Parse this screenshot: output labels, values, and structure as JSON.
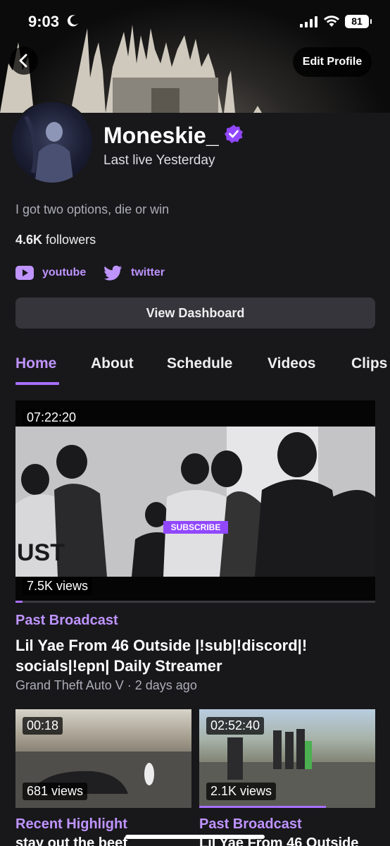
{
  "status_bar": {
    "time": "9:03",
    "battery": "81"
  },
  "header": {
    "edit_profile_label": "Edit Profile"
  },
  "profile": {
    "display_name": "Moneskie_",
    "last_live": "Last live Yesterday",
    "bio": "I got two options, die or win",
    "followers_count": "4.6K",
    "followers_label": "followers",
    "socials": [
      {
        "label": "youtube",
        "icon": "youtube-icon"
      },
      {
        "label": "twitter",
        "icon": "twitter-icon"
      }
    ],
    "view_dashboard_label": "View Dashboard"
  },
  "tabs": [
    {
      "label": "Home",
      "active": true
    },
    {
      "label": "About"
    },
    {
      "label": "Schedule"
    },
    {
      "label": "Videos"
    },
    {
      "label": "Clips"
    }
  ],
  "featured": {
    "duration": "07:22:20",
    "views": "7.5K views",
    "overlay_text": "SUBSCRIBE",
    "category": "Past Broadcast",
    "title": "Lil Yae From 46 Outside |!sub|!discord|! socials|!epn| Daily Streamer",
    "meta": "Grand Theft Auto V · 2 days ago",
    "progress": 0.02
  },
  "videos": [
    {
      "duration": "00:18",
      "views": "681 views",
      "category": "Recent Highlight",
      "title": "stay out the beef",
      "progress": 0.0
    },
    {
      "duration": "02:52:40",
      "views": "2.1K views",
      "category": "Past Broadcast",
      "title": "Lil Yae From 46 Outside",
      "progress": 0.72
    }
  ],
  "colors": {
    "accent": "#bf94ff",
    "brand": "#9147ff",
    "background": "#18181b"
  }
}
